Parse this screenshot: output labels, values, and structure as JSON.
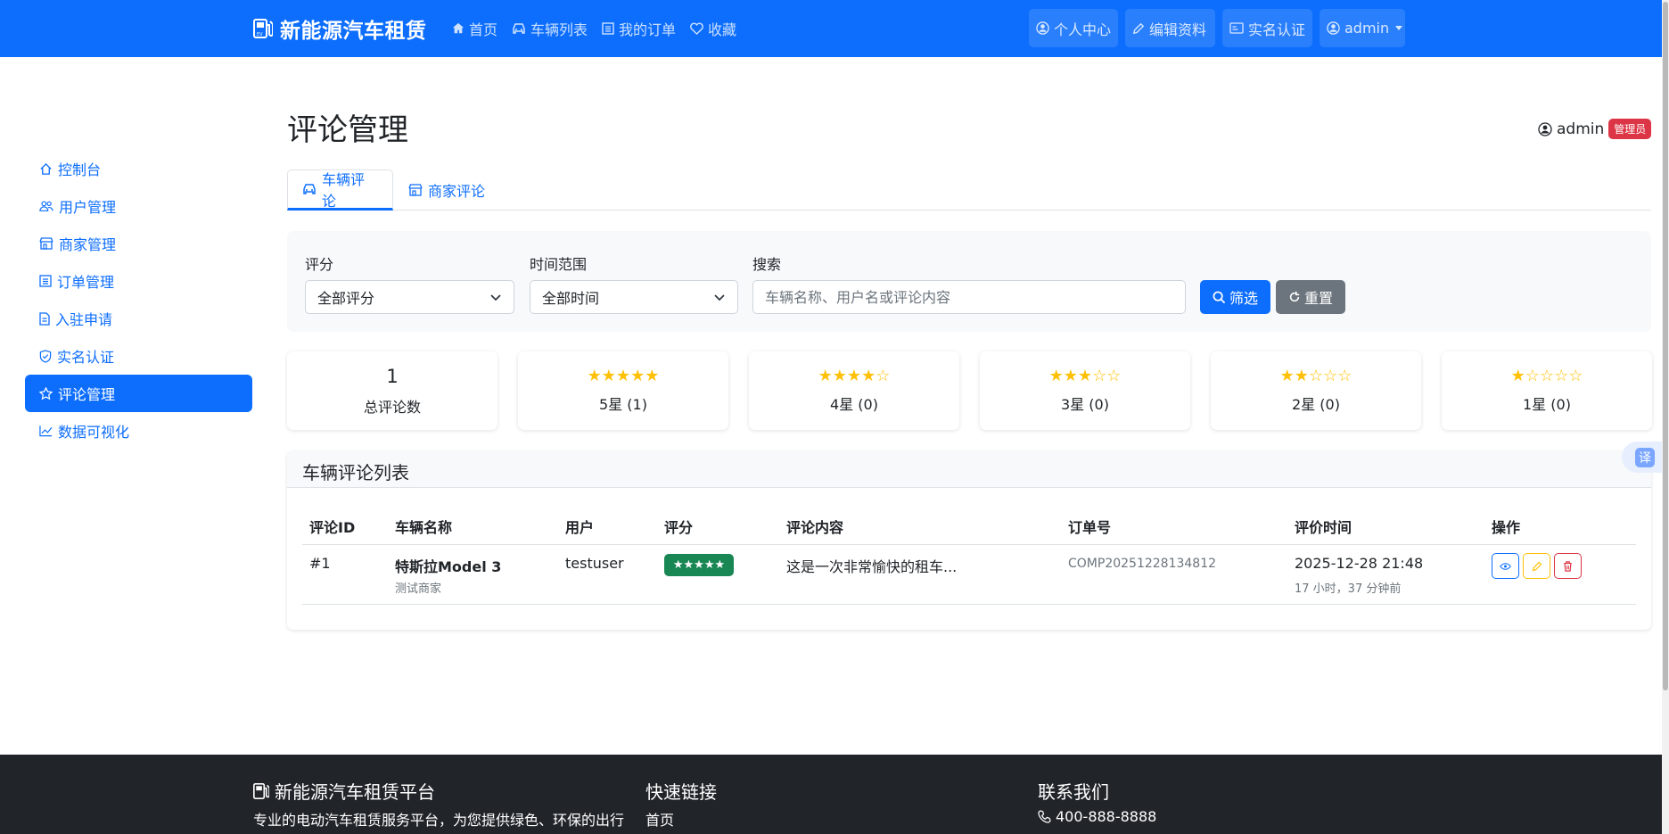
{
  "navbar": {
    "brand": "新能源汽车租赁",
    "links": [
      "首页",
      "车辆列表",
      "我的订单",
      "收藏"
    ],
    "right": [
      "个人中心",
      "编辑资料",
      "实名认证",
      "admin"
    ]
  },
  "sidebar": {
    "items": [
      "控制台",
      "用户管理",
      "商家管理",
      "订单管理",
      "入驻申请",
      "实名认证",
      "评论管理",
      "数据可视化"
    ],
    "active": "评论管理"
  },
  "header": {
    "title": "评论管理",
    "user": "admin",
    "role": "管理员"
  },
  "tabs": [
    "车辆评论",
    "商家评论"
  ],
  "filter": {
    "rating_label": "评分",
    "rating_value": "全部评分",
    "time_label": "时间范围",
    "time_value": "全部时间",
    "search_label": "搜索",
    "search_placeholder": "车辆名称、用户名或评论内容",
    "filter_button": "筛选",
    "reset_button": "重置"
  },
  "stats": {
    "total_value": "1",
    "total_label": "总评论数",
    "stars": [
      {
        "stars": "★★★★★",
        "label": "5星 (1)"
      },
      {
        "stars": "★★★★☆",
        "label": "4星 (0)"
      },
      {
        "stars": "★★★☆☆",
        "label": "3星 (0)"
      },
      {
        "stars": "★★☆☆☆",
        "label": "2星 (0)"
      },
      {
        "stars": "★☆☆☆☆",
        "label": "1星 (0)"
      }
    ]
  },
  "list": {
    "title": "车辆评论列表",
    "columns": [
      "评论ID",
      "车辆名称",
      "用户",
      "评分",
      "评论内容",
      "订单号",
      "评价时间",
      "操作"
    ],
    "rows": [
      {
        "id": "#1",
        "vehicle": "特斯拉Model 3",
        "merchant": "测试商家",
        "user": "testuser",
        "rating": "★★★★★",
        "content": "这是一次非常愉快的租车...",
        "order": "COMP20251228134812",
        "time": "2025-12-28 21:48",
        "relative": "17 小时，37 分钟前"
      }
    ]
  },
  "translate_label": "译",
  "footer": {
    "brand": "新能源汽车租赁平台",
    "desc": "专业的电动汽车租赁服务平台，为您提供绿色、环保的出行",
    "links_title": "快速链接",
    "link_first": "首页",
    "contact_title": "联系我们",
    "phone": "400-888-8888"
  },
  "colors": {
    "primary": "#0d6efd",
    "success": "#198754",
    "danger": "#dc3545",
    "warning": "#ffc107",
    "secondary": "#6c757d",
    "footer_bg": "#212529"
  }
}
